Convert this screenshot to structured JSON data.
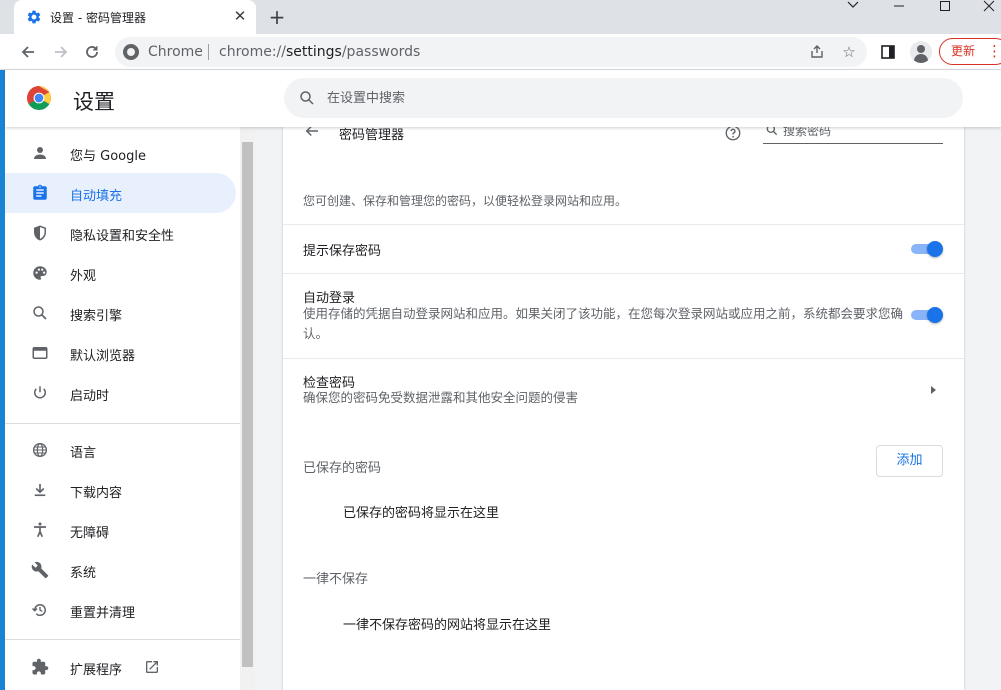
{
  "window": {
    "tab_title": "设置 - 密码管理器",
    "tab_close_icon": "close-icon",
    "new_tab_icon": "plus-icon",
    "controls": [
      "chevron-down-icon",
      "minimize-icon",
      "maximize-icon",
      "close-icon"
    ]
  },
  "toolbar": {
    "site_label": "Chrome",
    "url_prefix": "chrome://",
    "url_host": "settings",
    "url_path": "/passwords",
    "update_label": "更新"
  },
  "header": {
    "title": "设置",
    "search_placeholder": "在设置中搜索"
  },
  "sidebar": {
    "items": [
      {
        "label": "您与 Google",
        "icon": "person-icon"
      },
      {
        "label": "自动填充",
        "icon": "assignment-icon",
        "active": true
      },
      {
        "label": "隐私设置和安全性",
        "icon": "shield-icon"
      },
      {
        "label": "外观",
        "icon": "palette-icon"
      },
      {
        "label": "搜索引擎",
        "icon": "search-icon"
      },
      {
        "label": "默认浏览器",
        "icon": "browser-icon"
      },
      {
        "label": "启动时",
        "icon": "power-icon"
      },
      {
        "label": "语言",
        "icon": "globe-icon"
      },
      {
        "label": "下载内容",
        "icon": "download-icon"
      },
      {
        "label": "无障碍",
        "icon": "accessibility-icon"
      },
      {
        "label": "系统",
        "icon": "wrench-icon"
      },
      {
        "label": "重置并清理",
        "icon": "restore-icon"
      },
      {
        "label": "扩展程序",
        "icon": "puzzle-icon"
      }
    ]
  },
  "main": {
    "page_title": "密码管理器",
    "search_placeholder": "搜索密码",
    "intro": "您可创建、保存和管理您的密码，以便轻松登录网站和应用。",
    "offer_to_save": {
      "title": "提示保存密码",
      "enabled": true
    },
    "auto_signin": {
      "title": "自动登录",
      "description": "使用存储的凭据自动登录网站和应用。如果关闭了该功能，在您每次登录网站或应用之前，系统都会要求您确认。",
      "enabled": true
    },
    "check_passwords": {
      "title": "检查密码",
      "description": "确保您的密码免受数据泄露和其他安全问题的侵害"
    },
    "saved_passwords": {
      "title": "已保存的密码",
      "add_label": "添加",
      "empty": "已保存的密码将显示在这里"
    },
    "never_saved": {
      "title": "一律不保存",
      "empty": "一律不保存密码的网站将显示在这里"
    }
  },
  "colors": {
    "accent": "#1a73e8",
    "update": "#d93025"
  }
}
